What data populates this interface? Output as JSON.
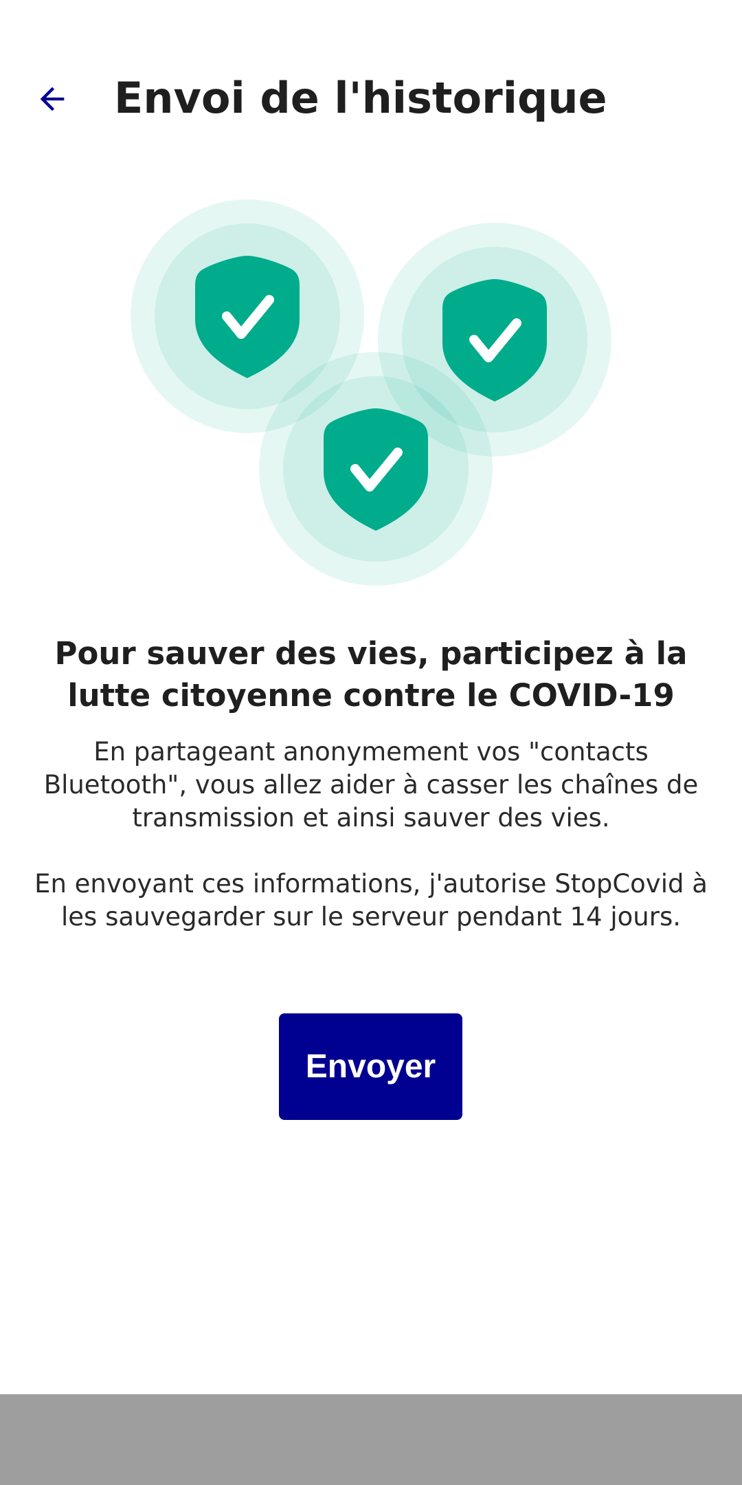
{
  "header": {
    "back_icon": "arrow-left-icon",
    "title": "Envoi de l'historique"
  },
  "illustration": {
    "icon": "shield-check-icon",
    "count": 3,
    "shield_color": "#00AC8C",
    "halo_color": "#00AC8C"
  },
  "content": {
    "headline": "Pour sauver des vies, participez à la lutte citoyenne contre le COVID-19",
    "paragraph_1": "En partageant anonymement vos \"contacts Bluetooth\", vous allez aider à casser les chaînes de transmission et ainsi sauver des vies.",
    "paragraph_2": "En envoyant ces informations, j'autorise StopCovid à les sauvegarder sur le serveur pendant 14 jours."
  },
  "actions": {
    "send_label": "Envoyer",
    "send_color": "#000091"
  },
  "colors": {
    "accent": "#000091",
    "system_nav_bar": "#9E9E9E"
  }
}
